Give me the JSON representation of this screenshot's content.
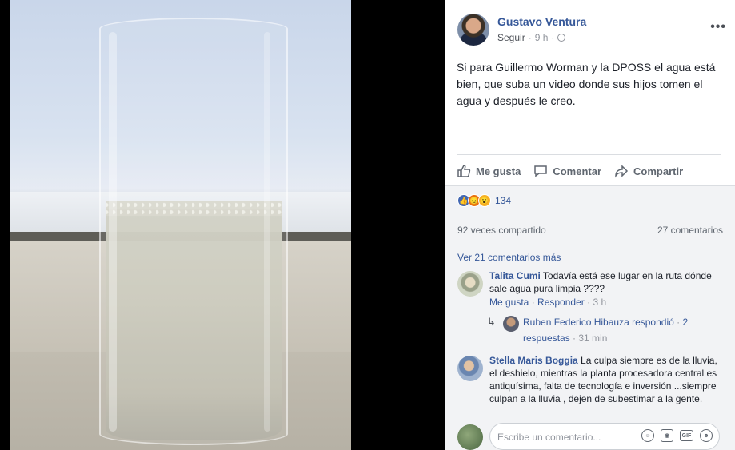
{
  "post": {
    "author": "Gustavo Ventura",
    "follow_label": "Seguir",
    "separator": "·",
    "time": "9 h",
    "more_label": "•••",
    "text": "Si para Guillermo Worman y la DPOSS el agua está bien, que suba un video donde sus hijos tomen el agua y después le creo."
  },
  "actions": {
    "like": "Me gusta",
    "comment": "Comentar",
    "share": "Compartir"
  },
  "stats": {
    "reaction_count": "134",
    "shared": "92 veces compartido",
    "comments": "27 comentarios",
    "view_more": "Ver 21 comentarios más"
  },
  "comments": [
    {
      "name": "Talita Cumi",
      "text": "Todavía está ese lugar en la ruta dónde sale agua pura limpia ????",
      "like": "Me gusta",
      "reply": "Responder",
      "time": "3 h",
      "reply_summary": {
        "text": "Ruben Federico Hibauza respondió",
        "separator": " · ",
        "count": "2 respuestas",
        "time": "31 min"
      }
    },
    {
      "name": "Stella Maris Boggia",
      "text": "La culpa siempre es de la lluvia, el deshielo, mientras la planta procesadora central es antiquísima, falta de tecnología e inversión ...siempre culpan a la lluvia , dejen de subestimar a la gente."
    }
  ],
  "composer": {
    "placeholder": "Escribe un comentario...",
    "gif_label": "GIF"
  },
  "colors": {
    "link": "#365899",
    "like_blue": "#4267b2",
    "angry": "#e9710f",
    "wow": "#f7b125"
  }
}
